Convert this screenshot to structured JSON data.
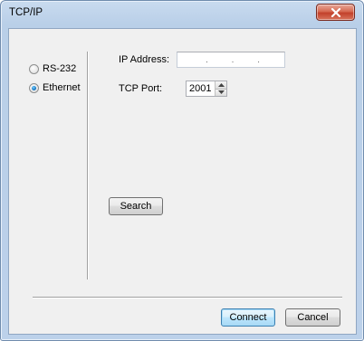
{
  "window": {
    "title": "TCP/IP"
  },
  "connection": {
    "options": [
      {
        "label": "RS-232",
        "selected": false
      },
      {
        "label": "Ethernet",
        "selected": true
      }
    ]
  },
  "fields": {
    "ip_label": "IP Address:",
    "ip_value": ". . .",
    "port_label": "TCP Port:",
    "port_value": "2001"
  },
  "buttons": {
    "search": "Search",
    "connect": "Connect",
    "cancel": "Cancel"
  },
  "icons": {
    "close": "close-icon",
    "spin_up": "chevron-up-icon",
    "spin_down": "chevron-down-icon"
  },
  "colors": {
    "close_button": "#c2412b",
    "window_frame": "#b9cfe8",
    "dialog_bg": "#f0f0f0",
    "radio_selected": "#1f7fc9"
  }
}
